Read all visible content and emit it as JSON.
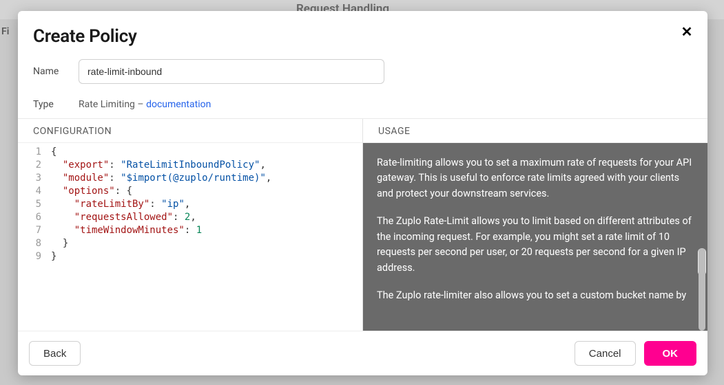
{
  "background": {
    "header": "Request Handling",
    "sidebar_word": "Fi"
  },
  "modal": {
    "title": "Create Policy",
    "close_glyph": "✕",
    "name_label": "Name",
    "name_value": "rate-limit-inbound",
    "type_label": "Type",
    "type_value": "Rate Limiting",
    "type_separator": " – ",
    "doc_link_text": "documentation",
    "config_header": "CONFIGURATION",
    "usage_header": "USAGE",
    "usage_paragraphs": [
      "Rate-limiting allows you to set a maximum rate of requests for your API gateway. This is useful to enforce rate limits agreed with your clients and protect your downstream services.",
      "The Zuplo Rate-Limit allows you to limit based on different attributes of the incoming request. For example, you might set a rate limit of 10 requests per second per user, or 20 requests per second for a given IP address.",
      "The Zuplo rate-limiter also allows you to set a custom bucket name by"
    ],
    "footer": {
      "back": "Back",
      "cancel": "Cancel",
      "ok": "OK"
    }
  },
  "config_json": {
    "export": "RateLimitInboundPolicy",
    "module": "$import(@zuplo/runtime)",
    "options": {
      "rateLimitBy": "ip",
      "requestsAllowed": 2,
      "timeWindowMinutes": 1
    }
  },
  "colors": {
    "accent": "#ff0090",
    "link": "#2563eb",
    "usage_bg": "#6a6a6a"
  }
}
